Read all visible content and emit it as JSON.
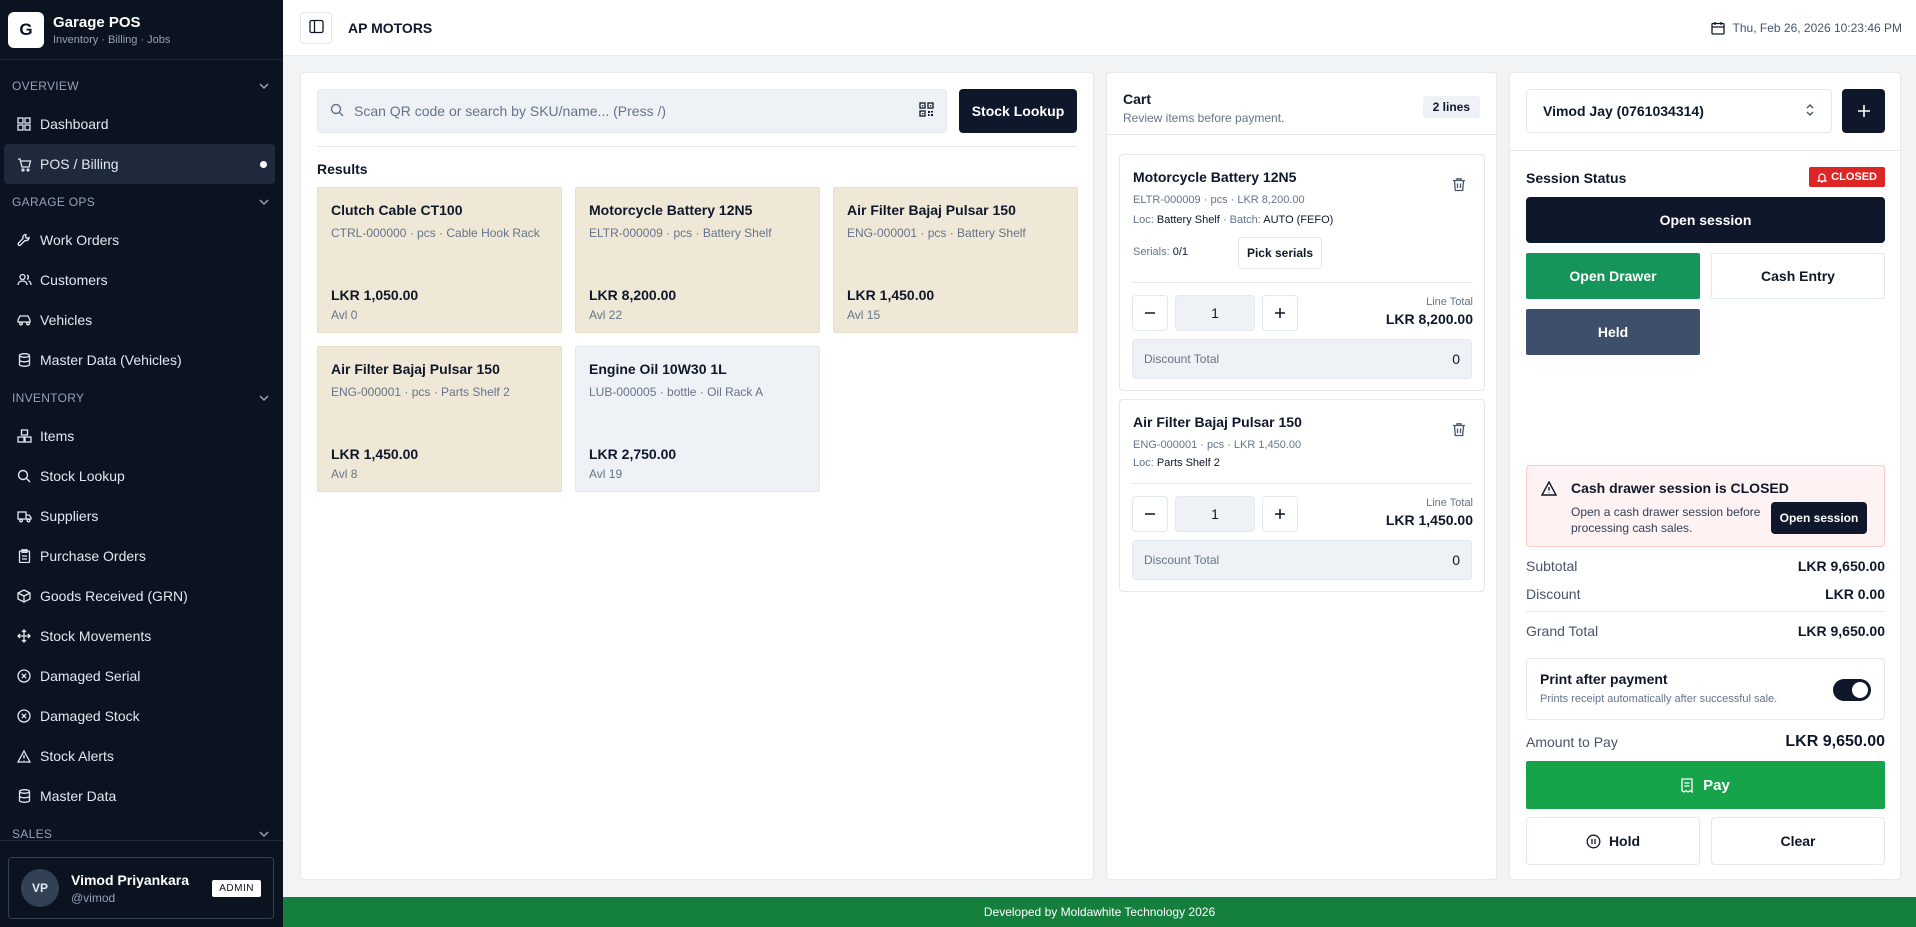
{
  "brand": {
    "logo_letter": "G",
    "title": "Garage POS",
    "subtitle": "Inventory · Billing · Jobs"
  },
  "sidebar": {
    "sections": {
      "overview": "OVERVIEW",
      "garage_ops": "GARAGE OPS",
      "inventory": "INVENTORY",
      "sales": "SALES"
    },
    "items": {
      "dashboard": "Dashboard",
      "pos_billing": "POS / Billing",
      "work_orders": "Work Orders",
      "customers": "Customers",
      "vehicles": "Vehicles",
      "master_data_vehicles": "Master Data (Vehicles)",
      "items": "Items",
      "stock_lookup": "Stock Lookup",
      "suppliers": "Suppliers",
      "purchase_orders": "Purchase Orders",
      "goods_received": "Goods Received (GRN)",
      "stock_movements": "Stock Movements",
      "damaged_serial": "Damaged Serial",
      "damaged_stock": "Damaged Stock",
      "stock_alerts": "Stock Alerts",
      "master_data": "Master Data"
    },
    "active": "pos_billing"
  },
  "user": {
    "initials": "VP",
    "name": "Vimod Priyankara",
    "handle": "@vimod",
    "role": "ADMIN"
  },
  "header": {
    "store_name": "AP MOTORS",
    "datetime": "Thu, Feb 26, 2026 10:23:46 PM"
  },
  "search": {
    "placeholder": "Scan QR code or search by SKU/name... (Press /)",
    "value": "",
    "stock_lookup_label": "Stock Lookup",
    "results_title": "Results"
  },
  "results": [
    {
      "name": "Clutch Cable CT100",
      "meta": "CTRL-000000 · pcs · Cable Hook Rack",
      "price": "LKR 1,050.00",
      "avl": "Avl 0",
      "tone": "warm"
    },
    {
      "name": "Motorcycle Battery 12N5",
      "meta": "ELTR-000009 · pcs · Battery Shelf",
      "price": "LKR 8,200.00",
      "avl": "Avl 22",
      "tone": "warm"
    },
    {
      "name": "Air Filter Bajaj Pulsar 150",
      "meta": "ENG-000001 · pcs · Battery Shelf",
      "price": "LKR 1,450.00",
      "avl": "Avl 15",
      "tone": "warm"
    },
    {
      "name": "Air Filter Bajaj Pulsar 150",
      "meta": "ENG-000001 · pcs · Parts Shelf 2",
      "price": "LKR 1,450.00",
      "avl": "Avl 8",
      "tone": "warm"
    },
    {
      "name": "Engine Oil 10W30 1L",
      "meta": "LUB-000005 · bottle · Oil Rack A",
      "price": "LKR 2,750.00",
      "avl": "Avl 19",
      "tone": "cool"
    }
  ],
  "cart": {
    "title": "Cart",
    "subtitle": "Review items before payment.",
    "lines_badge": "2 lines",
    "lines": [
      {
        "name": "Motorcycle Battery 12N5",
        "meta": "ELTR-000009 · pcs · LKR 8,200.00",
        "loc_label": "Loc: ",
        "loc": "Battery Shelf",
        "batch_label": " · Batch: ",
        "batch": "AUTO (FEFO)",
        "serials_label": "Serials: ",
        "serials": "0/1",
        "pick_serials_label": "Pick serials",
        "qty": "1",
        "line_total_label": "Line Total",
        "line_total": "LKR 8,200.00",
        "discount_label": "Discount Total",
        "discount": "0"
      },
      {
        "name": "Air Filter Bajaj Pulsar 150",
        "meta": "ENG-000001 · pcs · LKR 1,450.00",
        "loc_label": "Loc: ",
        "loc": "Parts Shelf 2",
        "qty": "1",
        "line_total_label": "Line Total",
        "line_total": "LKR 1,450.00",
        "discount_label": "Discount Total",
        "discount": "0"
      }
    ]
  },
  "checkout": {
    "customer": "Vimod Jay (0761034314)",
    "session_title": "Session Status",
    "session_state": "CLOSED",
    "open_session_label": "Open session",
    "open_drawer_label": "Open Drawer",
    "cash_entry_label": "Cash Entry",
    "held_label": "Held",
    "alert_title": "Cash drawer session is CLOSED",
    "alert_text": "Open a cash drawer session before processing cash sales.",
    "alert_button": "Open session",
    "subtotal_label": "Subtotal",
    "subtotal": "LKR 9,650.00",
    "discount_label": "Discount",
    "discount": "LKR 0.00",
    "grand_total_label": "Grand Total",
    "grand_total": "LKR 9,650.00",
    "print_title": "Print after payment",
    "print_sub": "Prints receipt automatically after successful sale.",
    "print_enabled": true,
    "amount_label": "Amount to Pay",
    "amount": "LKR 9,650.00",
    "pay_label": "Pay",
    "hold_label": "Hold",
    "clear_label": "Clear"
  },
  "colors": {
    "sidebar_bg": "#0b1220",
    "primary_dark": "#0f172a",
    "success": "#16a34a",
    "danger": "#dc2626",
    "held": "#3d4f6b",
    "card_warm": "#f0e8d6",
    "footer": "#15803d"
  },
  "footer": {
    "text": "Developed by Moldawhite Technology 2026"
  }
}
